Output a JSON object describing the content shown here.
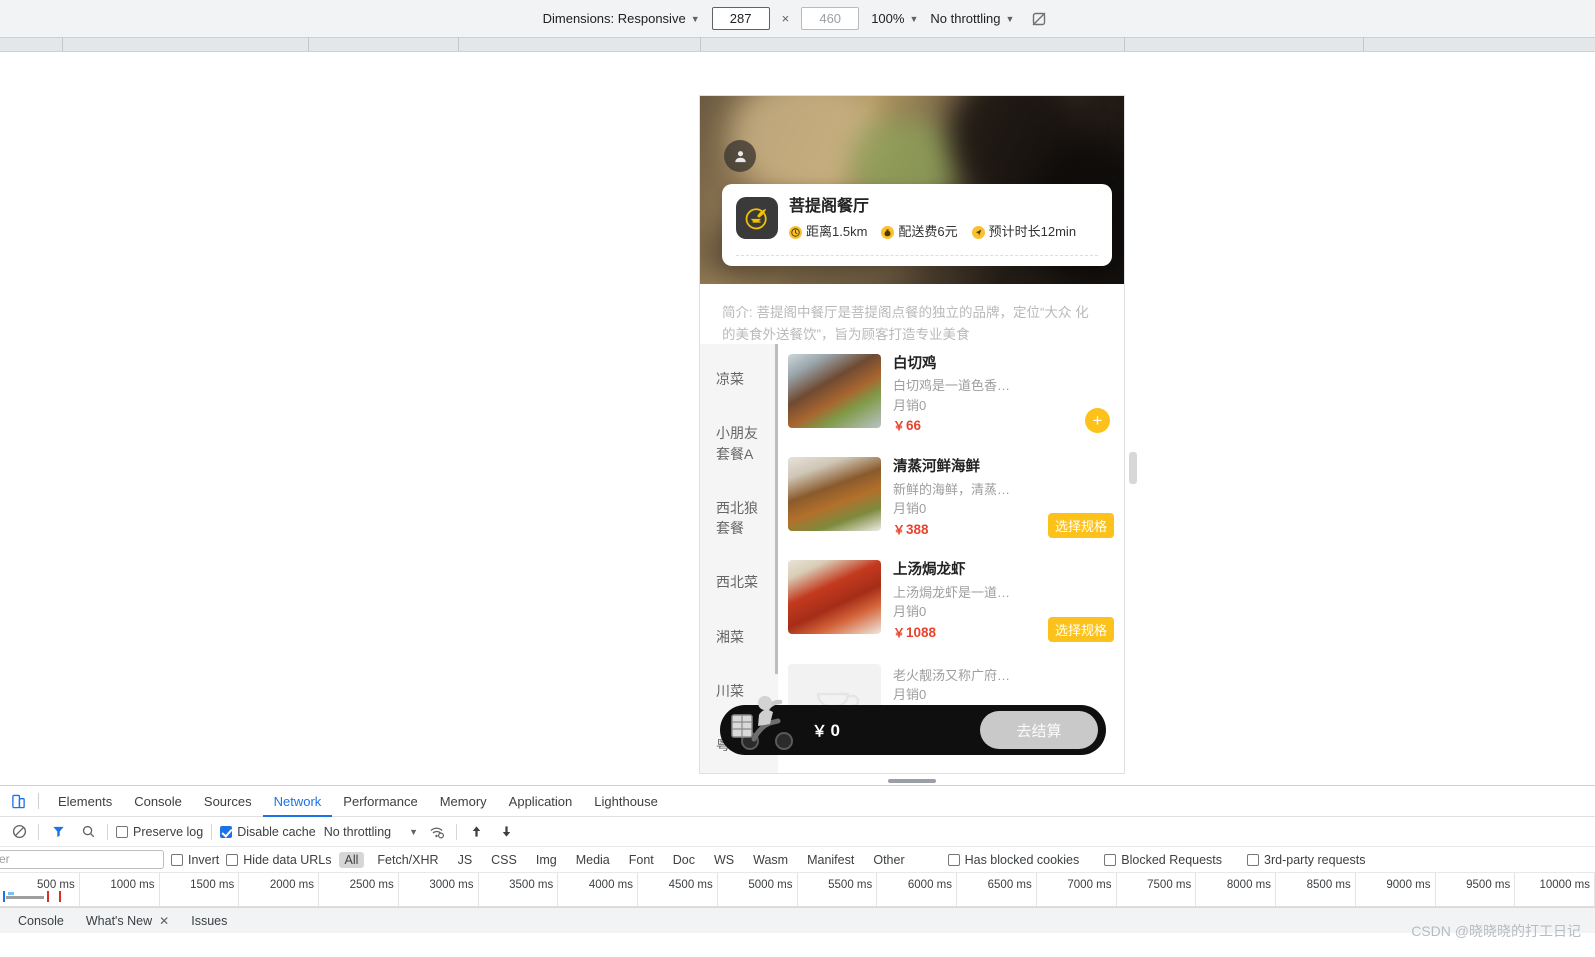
{
  "emulation_toolbar": {
    "dimensions_label": "Dimensions: Responsive",
    "width_value": "287",
    "height_placeholder": "460",
    "zoom_label": "100%",
    "throttling_label": "No throttling",
    "rotate_icon": "rotate-icon"
  },
  "mini_program": {
    "avatar_icon": "user-avatar-icon",
    "shop": {
      "logo_icon": "restaurant-logo-icon",
      "name": "菩提阁餐厅",
      "meta": [
        {
          "icon": "clock-icon",
          "text": "距离1.5km"
        },
        {
          "icon": "money-bag-icon",
          "text": "配送费6元"
        },
        {
          "icon": "navigation-icon",
          "text": "预计时长12min"
        }
      ]
    },
    "intro_text": "简介: 菩提阁中餐厅是菩提阁点餐的独立的品牌，定位“大众 化的美食外送餐饮”，旨为顾客打造专业美食",
    "categories": [
      "凉菜",
      "小朋友套餐A",
      "西北狼套餐",
      "西北菜",
      "湘菜",
      "川菜",
      "粤菜"
    ],
    "dishes": [
      {
        "name": "白切鸡",
        "desc": "白切鸡是一道色香…",
        "sales": "月销0",
        "currency": "￥",
        "price": "66",
        "action_type": "add",
        "action_label": "+"
      },
      {
        "name": "清蒸河鲜海鲜",
        "desc": "新鲜的海鲜，清蒸…",
        "sales": "月销0",
        "currency": "￥",
        "price": "388",
        "action_type": "spec",
        "action_label": "选择规格"
      },
      {
        "name": "上汤焗龙虾",
        "desc": "上汤焗龙虾是一道…",
        "sales": "月销0",
        "currency": "￥",
        "price": "1088",
        "action_type": "spec",
        "action_label": "选择规格"
      },
      {
        "name": "",
        "desc": "老火靓汤又称广府…",
        "sales": "月销0",
        "currency": "",
        "price": "",
        "action_type": "none",
        "action_label": ""
      }
    ],
    "cart": {
      "icon": "delivery-scooter-icon",
      "currency": "￥",
      "total": "0",
      "checkout_label": "去结算"
    }
  },
  "devtools": {
    "inspect_icon": "device-toggle-icon",
    "tabs": [
      {
        "label": "Elements",
        "active": false
      },
      {
        "label": "Console",
        "active": false
      },
      {
        "label": "Sources",
        "active": false
      },
      {
        "label": "Network",
        "active": true
      },
      {
        "label": "Performance",
        "active": false
      },
      {
        "label": "Memory",
        "active": false
      },
      {
        "label": "Application",
        "active": false
      },
      {
        "label": "Lighthouse",
        "active": false
      }
    ],
    "network_toolbar": {
      "clear_icon": "clear-icon",
      "filter_icon": "filter-icon",
      "search_icon": "search-icon",
      "preserve_log_label": "Preserve log",
      "preserve_log_checked": false,
      "disable_cache_label": "Disable cache",
      "disable_cache_checked": true,
      "throttling_label": "No throttling",
      "wifi_icon": "network-conditions-icon",
      "import_icon": "upload-har-icon",
      "export_icon": "download-har-icon"
    },
    "filter_row": {
      "filter_placeholder": "er",
      "invert_label": "Invert",
      "invert_checked": false,
      "hide_data_urls_label": "Hide data URLs",
      "hide_data_urls_checked": false,
      "types": [
        "All",
        "Fetch/XHR",
        "JS",
        "CSS",
        "Img",
        "Media",
        "Font",
        "Doc",
        "WS",
        "Wasm",
        "Manifest",
        "Other"
      ],
      "active_type": "All",
      "has_blocked_cookies_label": "Has blocked cookies",
      "has_blocked_cookies_checked": false,
      "blocked_requests_label": "Blocked Requests",
      "blocked_requests_checked": false,
      "third_party_label": "3rd-party requests",
      "third_party_checked": false
    },
    "timeline_ticks": [
      "500 ms",
      "1000 ms",
      "1500 ms",
      "2000 ms",
      "2500 ms",
      "3000 ms",
      "3500 ms",
      "4000 ms",
      "4500 ms",
      "5000 ms",
      "5500 ms",
      "6000 ms",
      "6500 ms",
      "7000 ms",
      "7500 ms",
      "8000 ms",
      "8500 ms",
      "9000 ms",
      "9500 ms",
      "10000 ms"
    ],
    "drawer_tabs": [
      {
        "label": "Console",
        "closable": false
      },
      {
        "label": "What's New",
        "closable": true
      },
      {
        "label": "Issues",
        "closable": false
      }
    ]
  },
  "watermark": "CSDN @晓晓晓的打工日记",
  "colors": {
    "accent_blue": "#1a73e8",
    "brand_yellow": "#fcc21b",
    "price_red": "#e8432c",
    "cart_black": "#0f0f0f"
  }
}
